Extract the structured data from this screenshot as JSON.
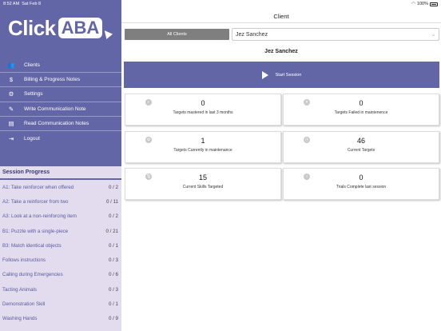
{
  "status": {
    "time": "8:52 AM",
    "date": "Sat Feb 8",
    "battery": "100%"
  },
  "logo": {
    "part1": "Click",
    "part2": "ABA"
  },
  "menu": [
    {
      "label": "Clients",
      "icon": "people-icon",
      "glyph": "👥"
    },
    {
      "label": "Billing & Progress Notes",
      "icon": "dollar-icon",
      "glyph": "$"
    },
    {
      "label": "Settings",
      "icon": "gear-icon",
      "glyph": "⚙"
    },
    {
      "label": "Write Communication Note",
      "icon": "pencil-icon",
      "glyph": "✎"
    },
    {
      "label": "Read Communication Notes",
      "icon": "notes-icon",
      "glyph": "▤"
    },
    {
      "label": "Logout",
      "icon": "logout-icon",
      "glyph": "⇥"
    }
  ],
  "session_progress": {
    "title": "Session Progress",
    "rows": [
      {
        "label": "A1: Take reinforcer when offered",
        "value": "0 / 2"
      },
      {
        "label": "A2: Take a reinforcer from two",
        "value": "0 / 11"
      },
      {
        "label": "A3: Look at a non-reinforcing item",
        "value": "0 / 2"
      },
      {
        "label": "B1: Puzzle with a single-piece",
        "value": "0 / 21"
      },
      {
        "label": "B3: Match identical objects",
        "value": "0 / 1"
      },
      {
        "label": "Follows instructions",
        "value": "0 / 3"
      },
      {
        "label": "Calling during Emergencies",
        "value": "0 / 6"
      },
      {
        "label": "Tacting Animals",
        "value": "0 / 3"
      },
      {
        "label": "Demonstration Skill",
        "value": "0 / 1"
      },
      {
        "label": "Washing Hands",
        "value": "0 / 9"
      }
    ]
  },
  "main": {
    "title": "Client",
    "all_clients_label": "All Clients",
    "client_select_value": "Jez Sanchez",
    "client_name": "Jez Sanchez",
    "start_session_label": "Start Session"
  },
  "stats": [
    {
      "value": "0",
      "label": "Targets mastered in last 3 months",
      "icon": "check-circle-icon",
      "glyph": "✓"
    },
    {
      "value": "0",
      "label": "Targets Failed in maintenence",
      "icon": "x-circle-icon",
      "glyph": "✕"
    },
    {
      "value": "1",
      "label": "Targets Currently in maintenance",
      "icon": "gear-icon",
      "glyph": "⚙"
    },
    {
      "value": "46",
      "label": "Current Targets",
      "icon": "clock-icon",
      "glyph": "◷"
    },
    {
      "value": "15",
      "label": "Current Skills Targeted",
      "icon": "microphone-icon",
      "glyph": "🎙"
    },
    {
      "value": "0",
      "label": "Trials Complete last session",
      "icon": "info-circle-icon",
      "glyph": "i"
    }
  ],
  "colors": {
    "brand": "#6366a6",
    "progress_bg": "#e2dcee",
    "button_gray": "#7f7f7f"
  }
}
